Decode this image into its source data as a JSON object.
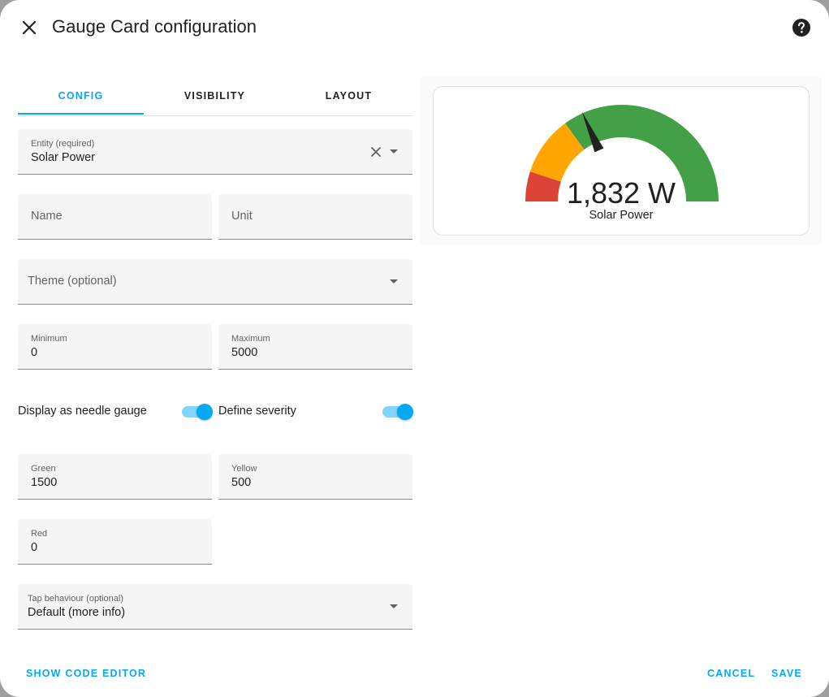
{
  "dialog": {
    "title": "Gauge Card configuration",
    "close_icon": "close-icon",
    "help_icon": "help-circle-icon"
  },
  "tabs": [
    {
      "label": "CONFIG",
      "active": true
    },
    {
      "label": "VISIBILITY",
      "active": false
    },
    {
      "label": "LAYOUT",
      "active": false
    }
  ],
  "form": {
    "entity": {
      "label": "Entity (required)",
      "value": "Solar Power"
    },
    "name": {
      "placeholder": "Name"
    },
    "unit": {
      "placeholder": "Unit"
    },
    "theme": {
      "placeholder": "Theme (optional)"
    },
    "minimum": {
      "label": "Minimum",
      "value": "0"
    },
    "maximum": {
      "label": "Maximum",
      "value": "5000"
    },
    "needle_toggle": {
      "label": "Display as needle gauge",
      "on": true
    },
    "severity_toggle": {
      "label": "Define severity",
      "on": true
    },
    "green": {
      "label": "Green",
      "value": "1500"
    },
    "yellow": {
      "label": "Yellow",
      "value": "500"
    },
    "red": {
      "label": "Red",
      "value": "0"
    },
    "tap_behaviour": {
      "label": "Tap behaviour (optional)",
      "value": "Default (more info)"
    }
  },
  "preview": {
    "value_text": "1,832 W",
    "name": "Solar Power",
    "value": 1832,
    "min": 0,
    "max": 5000,
    "severity": {
      "green": 1500,
      "yellow": 500,
      "red": 0
    },
    "colors": {
      "green": "#43a047",
      "yellow": "#ffa600",
      "red": "#db4437",
      "needle": "#212121"
    }
  },
  "footer": {
    "show_code_editor": "SHOW CODE EDITOR",
    "cancel": "CANCEL",
    "save": "SAVE"
  },
  "theme_colors": {
    "accent": "#03a9f4"
  }
}
